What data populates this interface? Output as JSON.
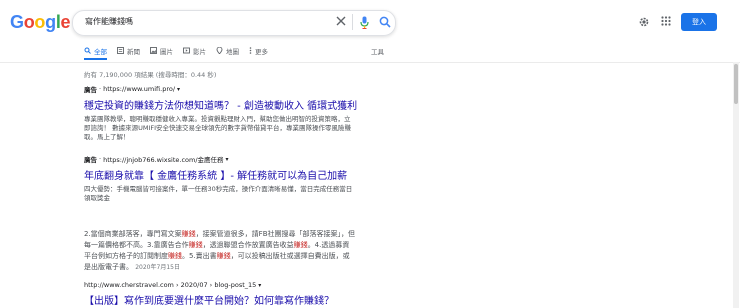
{
  "logo": {
    "letters": [
      "G",
      "o",
      "o",
      "g",
      "l",
      "e"
    ],
    "colors": [
      "#4285F4",
      "#EA4335",
      "#FBBC05",
      "#4285F4",
      "#34A853",
      "#EA4335"
    ]
  },
  "search": {
    "query": "寫作能賺錢嗎"
  },
  "header": {
    "signin_label": "登入",
    "accent": "#1a73e8"
  },
  "tabs": [
    {
      "label": "全部",
      "icon": "search-icon"
    },
    {
      "label": "新聞",
      "icon": "news-icon"
    },
    {
      "label": "圖片",
      "icon": "image-icon"
    },
    {
      "label": "影片",
      "icon": "video-icon"
    },
    {
      "label": "地圖",
      "icon": "map-pin-icon"
    },
    {
      "label": "更多",
      "icon": "more-vert-icon"
    }
  ],
  "tools_label": "工具",
  "stats": "約有 7,190,000 項結果 (搜尋時間：0.44 秒)",
  "results": [
    {
      "ad_label": "廣告",
      "url": "https://www.umifi.pro/",
      "title": "穩定投資的賺錢方法你想知道嗎？ - 創造被動收入 循環式獲利",
      "snippet": "專業團隊教學，聰明賺取穩健收入專業。投資觀點理財入門，幫助您做出明智的投資策略，立即諮詢！ 數據來源UMIFI安全快速交易全球領先的數字貨幣借貸平台，專業團隊操作零風險賺取。馬上了解！"
    },
    {
      "ad_label": "廣告",
      "url": "https://jnjob766.wixsite.com/金鷹任務",
      "title": "年底翻身就靠【 金鷹任務系統 】- 解任務就可以為自己加薪",
      "snippet": "四大優勢：手機電腦皆可接案件，單一任務30秒完成，操作介面清晰易懂，當日完成任務當日領取獎金"
    }
  ],
  "organic": {
    "snippet_parts": [
      "2.當個商業部落客，專門寫文案",
      "賺錢",
      "，接案管道很多，請FB社團搜尋「部落客接案」，但每一篇價格都不高。3.靠廣告合作",
      "賺錢",
      "，透過聯盟合作放置廣告收益",
      "賺錢",
      "。4.透過募資平台例如方格子的訂閱制度",
      "賺錢",
      "。5.賣出書",
      "賺錢",
      "，可以投稿出版社或選擇自費出版，或是出版電子書。"
    ],
    "date": "2020年7月15日",
    "url": "http://www.cherstravel.com › 2020/07 › blog-post_15",
    "title": "【出版】寫作到底要選什麼平台開始？如何靠寫作賺錢？"
  }
}
